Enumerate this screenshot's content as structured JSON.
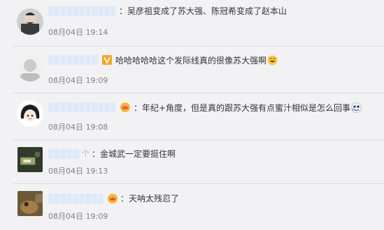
{
  "colors": {
    "background": "#f2f2f5",
    "text": "#333333",
    "timestamp": "#808080",
    "name_highlight": "#dce9f7",
    "vip_orange": "#f5a623"
  },
  "comments": [
    {
      "text": "：吴彦祖变成了苏大强、陈冠希变成了赵本山",
      "date": "08月04日",
      "time": "19:14",
      "badge": "",
      "emoji": ""
    },
    {
      "text": "哈哈哈哈哈这个发际线真的很像苏大强啊",
      "date": "08月04日",
      "time": "19:09",
      "badge": "vip-v-badge-icon",
      "emoji": "laughing-emoji-icon"
    },
    {
      "text": "：年纪+角度，但是真的跟苏大强有点蜜汁相似是怎么回事",
      "date": "08月04日",
      "time": "19:08",
      "badge": "crown-badge-icon",
      "emoji": "crying-laughing-emoji-icon"
    },
    {
      "text": "：金城武一定要挺住啊",
      "date": "08月04日",
      "time": "19:13",
      "badge": "",
      "emoji": ""
    },
    {
      "text": "：天呐太残忍了",
      "date": "08月04日",
      "time": "19:09",
      "badge": "crown-badge-icon",
      "emoji": ""
    }
  ]
}
